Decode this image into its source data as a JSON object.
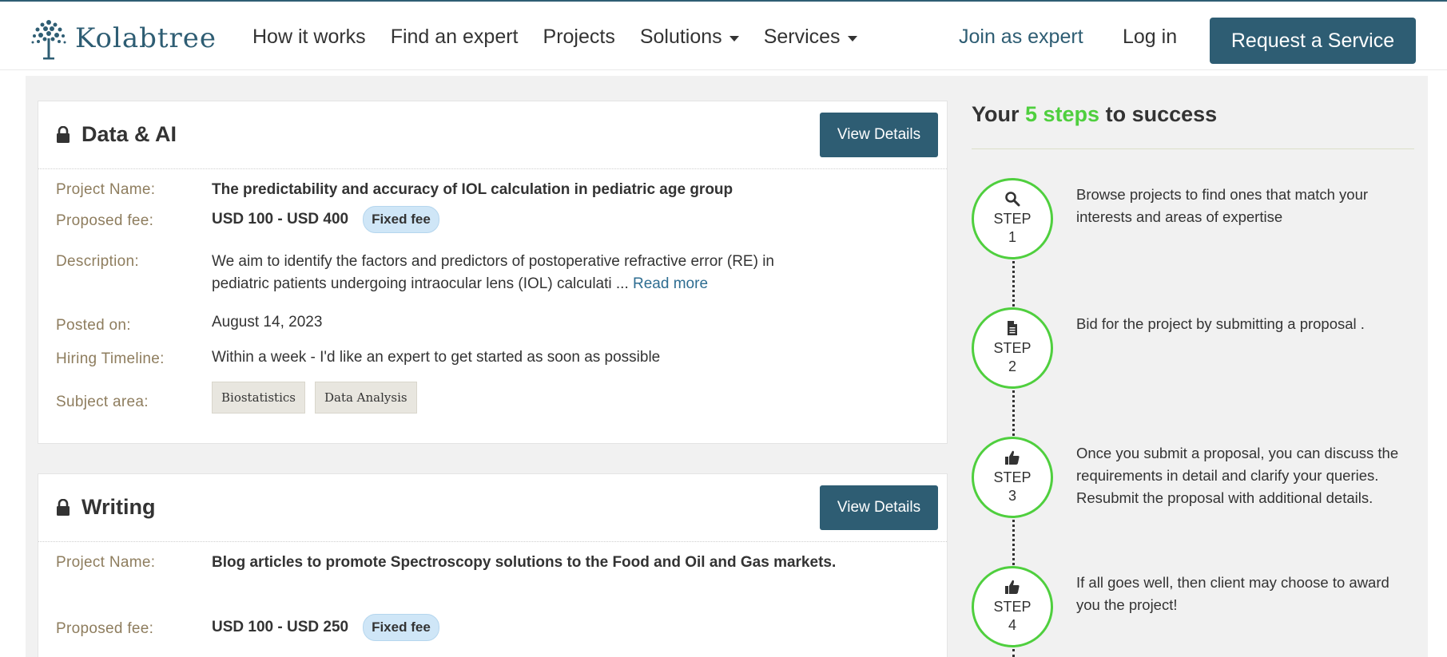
{
  "header": {
    "logo_text": "Kolabtree",
    "nav": [
      {
        "label": "How it works",
        "has_caret": false
      },
      {
        "label": "Find an expert",
        "has_caret": false
      },
      {
        "label": "Projects",
        "has_caret": false
      },
      {
        "label": "Solutions",
        "has_caret": true
      },
      {
        "label": "Services",
        "has_caret": true
      }
    ],
    "join_label": "Join as expert",
    "login_label": "Log in",
    "request_label": "Request a Service"
  },
  "projects": [
    {
      "category": "Data & AI",
      "view_label": "View Details",
      "labels": {
        "name": "Project Name:",
        "fee": "Proposed fee:",
        "description": "Description:",
        "posted": "Posted on:",
        "timeline": "Hiring Timeline:",
        "subject": "Subject area:"
      },
      "name": "The predictability and accuracy of IOL calculation in pediatric age group",
      "fee": "USD 100 - USD 400",
      "fee_badge": "Fixed fee",
      "description": "We aim to identify the factors and predictors of postoperative refractive error (RE) in pediatric patients undergoing intraocular lens (IOL) calculati ...",
      "read_more": "Read more",
      "posted": "August 14, 2023",
      "timeline": "Within a week - I'd like an expert to get started as soon as possible",
      "subjects": [
        "Biostatistics",
        "Data Analysis"
      ]
    },
    {
      "category": "Writing",
      "view_label": "View Details",
      "labels": {
        "name": "Project Name:",
        "fee": "Proposed fee:"
      },
      "name": "Blog articles to promote Spectroscopy solutions to the Food and Oil and Gas markets.",
      "fee": "USD 100 - USD 250",
      "fee_badge": "Fixed fee"
    }
  ],
  "sidebar": {
    "title_prefix": "Your",
    "title_highlight": "5 steps",
    "title_suffix": "to success",
    "accent_color": "#4fcf3e",
    "steps": [
      {
        "word": "STEP",
        "num": "1",
        "icon": "search-icon",
        "text": "Browse projects to find ones that match your interests and areas of expertise"
      },
      {
        "word": "STEP",
        "num": "2",
        "icon": "document-icon",
        "text": "Bid for the project by submitting a proposal ."
      },
      {
        "word": "STEP",
        "num": "3",
        "icon": "thumbs-up-icon",
        "text": "Once you submit a proposal, you can discuss the requirements in detail and clarify your queries. Resubmit the proposal with additional details."
      },
      {
        "word": "STEP",
        "num": "4",
        "icon": "thumbs-up-icon",
        "text": "If all goes well, then client may choose to award you the project!"
      }
    ]
  },
  "colors": {
    "brand": "#2e5d73",
    "label": "#8e7d5e",
    "badge_bg": "#cfe6f7"
  }
}
